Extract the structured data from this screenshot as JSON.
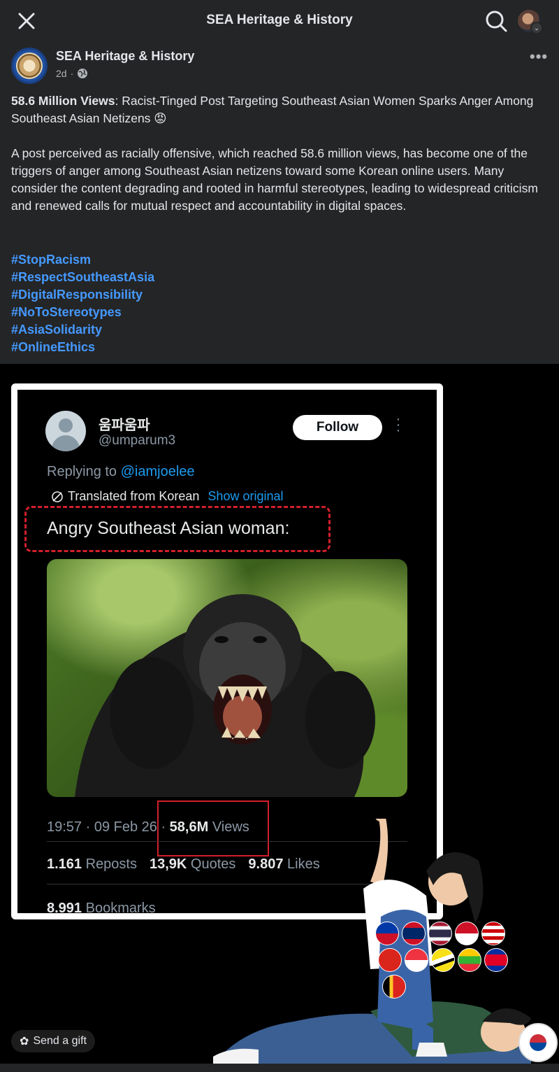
{
  "topbar": {
    "title": "SEA Heritage & History"
  },
  "post": {
    "page_name": "SEA Heritage & History",
    "time": "2d",
    "headline_bold": "58.6 Million Views",
    "headline_rest": ": Racist-Tinged Post Targeting Southeast Asian Women Sparks Anger Among Southeast Asian Netizens 😡",
    "body": "A post perceived as racially offensive, which reached 58.6 million views, has become one of the triggers of anger among Southeast Asian netizens toward some Korean online users. Many consider the content degrading and rooted in harmful stereotypes, leading to widespread criticism and renewed calls for mutual respect and accountability in digital spaces.",
    "hashtags": [
      "#StopRacism",
      "#RespectSoutheastAsia",
      "#DigitalResponsibility",
      "#NoToStereotypes",
      "#AsiaSolidarity",
      "#OnlineEthics"
    ]
  },
  "tweet": {
    "name": "움파움파",
    "handle": "@umparum3",
    "follow_label": "Follow",
    "replying_prefix": "Replying to ",
    "replying_to": "@iamjoelee",
    "translated_label": "Translated from Korean",
    "show_original": "Show original",
    "text": "Angry Southeast Asian woman:",
    "timestamp": "19:57 · 09 Feb 26 · ",
    "views_count": "58,6M",
    "views_label": " Views",
    "reposts_count": "1.161",
    "reposts_label": " Reposts",
    "quotes_count": "13,9K",
    "quotes_label": " Quotes",
    "likes_count": "9.807",
    "likes_label": " Likes",
    "bookmarks_count": "8.991",
    "bookmarks_label": " Bookmarks"
  },
  "gift": {
    "label": "Send a gift"
  },
  "icons": {
    "close": "close-icon",
    "search": "search-icon",
    "more": "more-icon",
    "globe": "globe-icon",
    "translate": "translate-icon",
    "gift": "gift-icon"
  },
  "colors": {
    "background": "#242526",
    "hashtag": "#4599ff",
    "twitter_link": "#1d9bf0",
    "highlight_red": "#d21f2c"
  }
}
